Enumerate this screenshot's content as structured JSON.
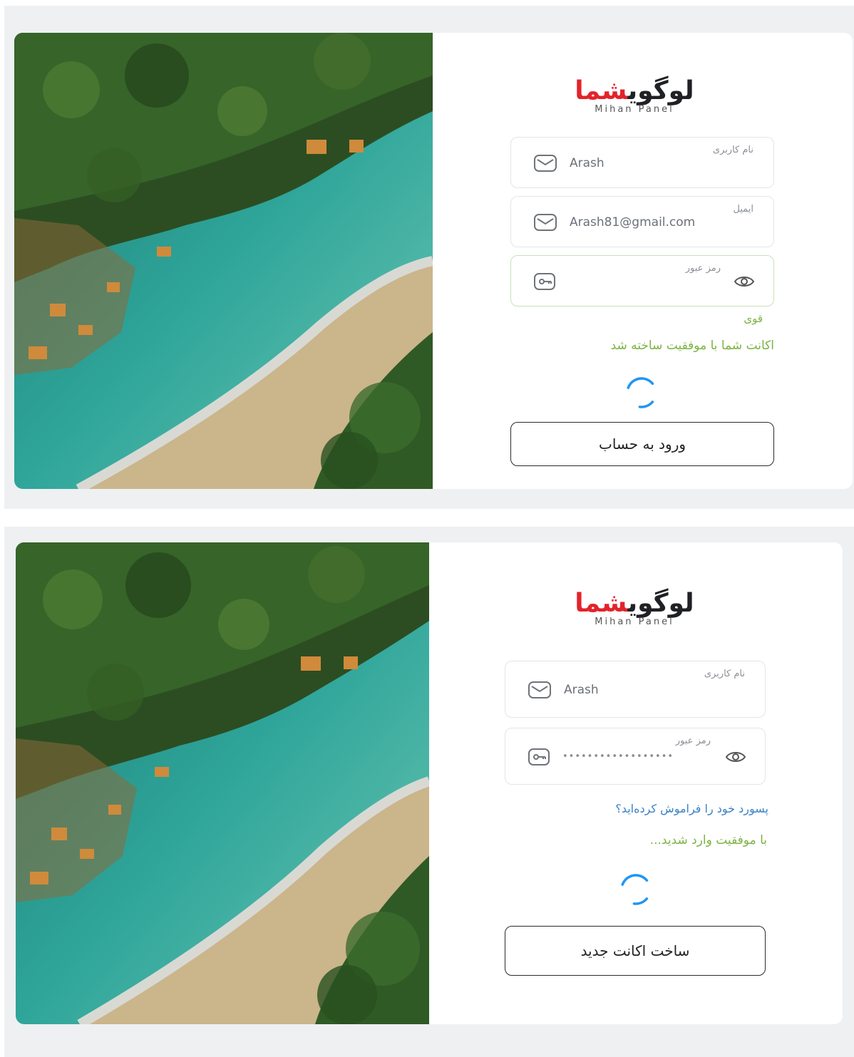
{
  "register_screen": {
    "logo": {
      "main_black": "لوگوی",
      "main_red": "شما",
      "sub": "Mihan Panel"
    },
    "fields": [
      {
        "label": "نام کاربری",
        "value": "Arash",
        "icon": "envelope-icon"
      },
      {
        "label": "ایمیل",
        "value": "Arash81@gmail.com",
        "icon": "envelope-icon"
      },
      {
        "label": "رمز عبور",
        "value": "",
        "icon": "key-icon",
        "suffix_icon": "eye-icon"
      }
    ],
    "strength_text": "قوی",
    "success_text": "اکانت شما با موفقیت ساخته شد",
    "button_label": "ورود به حساب"
  },
  "login_screen": {
    "logo": {
      "main_black": "لوگوی",
      "main_red": "شما",
      "sub": "Mihan Panel"
    },
    "fields": [
      {
        "label": "نام کاربری",
        "value": "Arash",
        "icon": "envelope-icon"
      },
      {
        "label": "رمز عبور",
        "value": "••••••••••••••••••",
        "icon": "key-icon",
        "suffix_icon": "eye-icon"
      }
    ],
    "forgot_text": "پسورد خود را فراموش کرده‌اید؟",
    "success_text": "با موفقیت وارد شدید...",
    "button_label": "ساخت اکانت جدید"
  },
  "colors": {
    "accent_green": "#7cb342",
    "logo_red": "#e3232b",
    "link_blue": "#3b82c4",
    "spinner_blue": "#2196f3"
  }
}
